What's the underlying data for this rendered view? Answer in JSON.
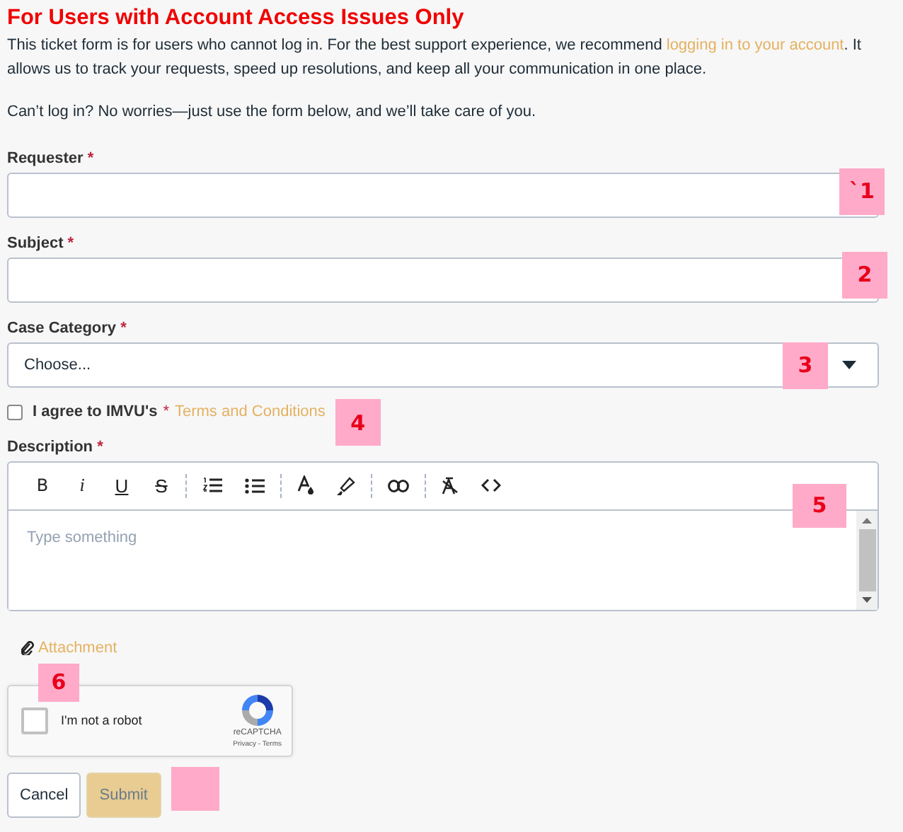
{
  "heading": "For Users with Account Access Issues Only",
  "intro": {
    "before": "This ticket form is for users who cannot log in. For the best support experience, we recommend ",
    "link": "logging in to your account",
    "after": ". It allows us to track your requests, speed up resolutions, and keep all your communication in one place."
  },
  "note": "Can’t log in? No worries—just use the form below, and we’ll take care of you.",
  "requester": {
    "label": "Requester",
    "required": "*",
    "marker": "`1"
  },
  "subject": {
    "label": "Subject",
    "required": "*",
    "marker": "2"
  },
  "category": {
    "label": "Case Category",
    "required": "*",
    "value": "Choose...",
    "marker": "3"
  },
  "agree": {
    "checked": false,
    "label": "I agree to IMVU's",
    "required": "*",
    "link": "Terms and Conditions",
    "marker": "4"
  },
  "description": {
    "label": "Description",
    "required": "*",
    "placeholder": "Type something",
    "marker": "5",
    "toolbar": [
      {
        "kind": "bold",
        "label": "B"
      },
      {
        "kind": "italic",
        "label": "i"
      },
      {
        "kind": "underline",
        "label": "U"
      },
      {
        "kind": "strike",
        "label": "S"
      },
      {
        "kind": "separator"
      },
      {
        "kind": "ordered-list"
      },
      {
        "kind": "bullet-list"
      },
      {
        "kind": "separator"
      },
      {
        "kind": "text-color"
      },
      {
        "kind": "highlight"
      },
      {
        "kind": "separator"
      },
      {
        "kind": "link"
      },
      {
        "kind": "separator"
      },
      {
        "kind": "clear-format"
      },
      {
        "kind": "code"
      }
    ]
  },
  "attachment": {
    "label": "Attachment",
    "marker": "6"
  },
  "captcha": {
    "checked": false,
    "label": "I'm not a robot",
    "brand": "reCAPTCHA",
    "links": "Privacy - Terms"
  },
  "buttons": [
    {
      "kind": "cancel",
      "label": "Cancel",
      "disabled": false,
      "marked": false
    },
    {
      "kind": "submit",
      "label": "Submit",
      "disabled": true,
      "marked": true
    }
  ]
}
